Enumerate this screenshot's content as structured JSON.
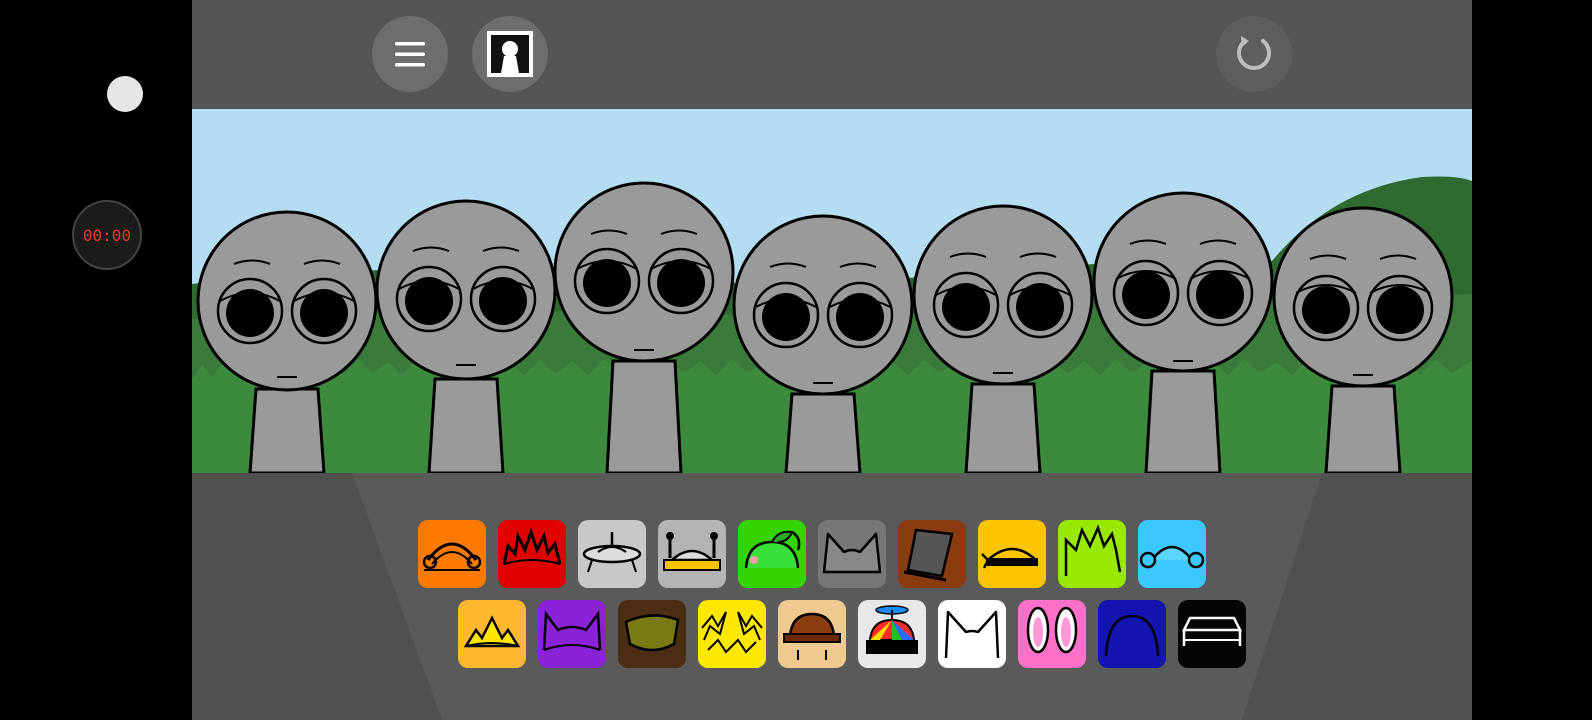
{
  "recorder": {
    "timer": "00:00",
    "record_icon": "record-dot-icon"
  },
  "toolbar": {
    "menu_icon": "hamburger-menu-icon",
    "photo_icon": "portrait-photo-icon",
    "reset_icon": "reset-icon"
  },
  "colors": {
    "sky": "#b5ddf2",
    "grass": "#3d8a3f",
    "character": "#9a9a9a",
    "stage": "#5a5a5a",
    "topbar": "#555555"
  },
  "characters": [
    {
      "name": "character-1",
      "expression": "sleepy"
    },
    {
      "name": "character-2",
      "expression": "sleepy"
    },
    {
      "name": "character-3",
      "expression": "sleepy"
    },
    {
      "name": "character-4",
      "expression": "sleepy"
    },
    {
      "name": "character-5",
      "expression": "sleepy"
    },
    {
      "name": "character-6",
      "expression": "sleepy"
    },
    {
      "name": "character-7",
      "expression": "sleepy"
    }
  ],
  "palette_row_1": [
    {
      "name": "orange-headphones",
      "color": "#ff7b00"
    },
    {
      "name": "red-spiky",
      "color": "#e00000"
    },
    {
      "name": "silver-ufo",
      "color": "#c8c8c8"
    },
    {
      "name": "gray-antenna",
      "color": "#b4b4b4"
    },
    {
      "name": "green-apple",
      "color": "#35d400"
    },
    {
      "name": "gray-cat-ears",
      "color": "#777777"
    },
    {
      "name": "brown-tophat",
      "color": "#8a3b10"
    },
    {
      "name": "yellow-headband",
      "color": "#ffc400"
    },
    {
      "name": "lime-spikes",
      "color": "#99e800"
    },
    {
      "name": "cyan-earmuffs",
      "color": "#3cc8ff"
    }
  ],
  "palette_row_2": [
    {
      "name": "sun-crown",
      "color": "#ffb830"
    },
    {
      "name": "purple-horns",
      "color": "#8a22d8"
    },
    {
      "name": "olive-helmet",
      "color": "#4a2d12"
    },
    {
      "name": "lightning-sparks",
      "color": "#ffe800"
    },
    {
      "name": "brown-hat",
      "color": "#f0c990"
    },
    {
      "name": "propeller-cap",
      "color": "#e8e8e8"
    },
    {
      "name": "white-cat-ears",
      "color": "#ffffff"
    },
    {
      "name": "pink-bunny-ears",
      "color": "#ff70c8"
    },
    {
      "name": "navy-dome",
      "color": "#1414b0"
    },
    {
      "name": "black-bench",
      "color": "#050505"
    }
  ]
}
